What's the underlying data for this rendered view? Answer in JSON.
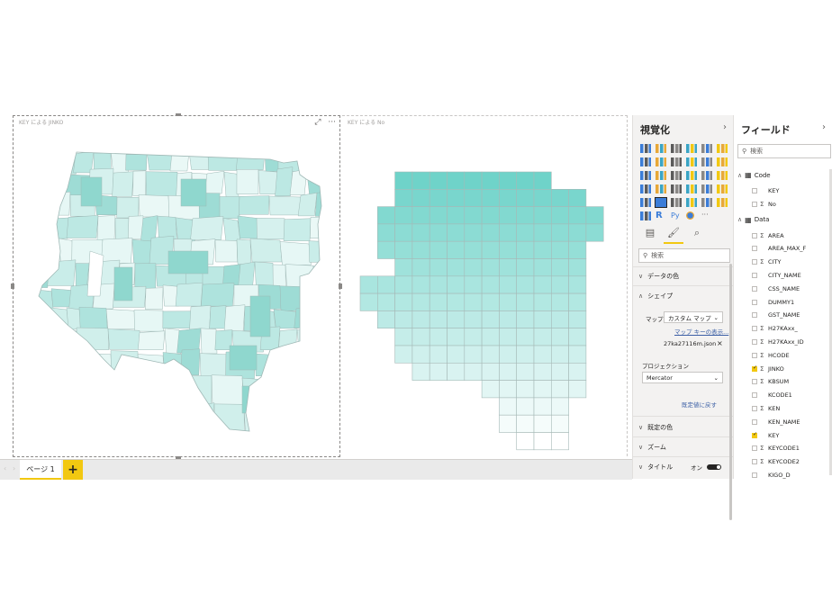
{
  "visuals": {
    "left_title": "KEY による JINKO",
    "right_title": "KEY による No"
  },
  "tabs": {
    "page_label": "ページ 1",
    "add_label": "+"
  },
  "viz_pane": {
    "title": "視覚化",
    "search_placeholder": "検索",
    "sections": {
      "data_colors": "データの色",
      "shape": "シェイプ",
      "default_color": "既定の色",
      "zoom": "ズーム",
      "title": "タイトル"
    },
    "map_label": "マップ",
    "map_value": "カスタム マップ",
    "map_key_link": "マップ キーの表示...",
    "map_file": "27ka27116m.json",
    "projection_label": "プロジェクション",
    "projection_value": "Mercator",
    "reset_link": "既定値に戻す",
    "title_toggle": "オン"
  },
  "fields_pane": {
    "title": "フィールド",
    "search_placeholder": "検索",
    "tables": [
      {
        "name": "Code",
        "fields": [
          {
            "label": "KEY",
            "sigma": false,
            "checked": false
          },
          {
            "label": "No",
            "sigma": true,
            "checked": false
          }
        ]
      },
      {
        "name": "Data",
        "fields": [
          {
            "label": "AREA",
            "sigma": true,
            "checked": false
          },
          {
            "label": "AREA_MAX_F",
            "sigma": false,
            "checked": false
          },
          {
            "label": "CITY",
            "sigma": true,
            "checked": false
          },
          {
            "label": "CITY_NAME",
            "sigma": false,
            "checked": false
          },
          {
            "label": "CSS_NAME",
            "sigma": false,
            "checked": false
          },
          {
            "label": "DUMMY1",
            "sigma": false,
            "checked": false
          },
          {
            "label": "GST_NAME",
            "sigma": false,
            "checked": false
          },
          {
            "label": "H27KAxx_",
            "sigma": true,
            "checked": false
          },
          {
            "label": "H27KAxx_ID",
            "sigma": true,
            "checked": false
          },
          {
            "label": "HCODE",
            "sigma": true,
            "checked": false
          },
          {
            "label": "JINKO",
            "sigma": true,
            "checked": true
          },
          {
            "label": "KBSUM",
            "sigma": true,
            "checked": false
          },
          {
            "label": "KCODE1",
            "sigma": false,
            "checked": false
          },
          {
            "label": "KEN",
            "sigma": true,
            "checked": false
          },
          {
            "label": "KEN_NAME",
            "sigma": false,
            "checked": false
          },
          {
            "label": "KEY",
            "sigma": false,
            "checked": true
          },
          {
            "label": "KEYCODE1",
            "sigma": true,
            "checked": false
          },
          {
            "label": "KEYCODE2",
            "sigma": true,
            "checked": false
          },
          {
            "label": "KIGO_D",
            "sigma": false,
            "checked": false
          }
        ]
      }
    ]
  },
  "colors": {
    "accent": "#f2c811",
    "map_fill": "#c9ede9",
    "map_dark": "#7fd5cc",
    "grid_top": "#6fd3c9"
  }
}
